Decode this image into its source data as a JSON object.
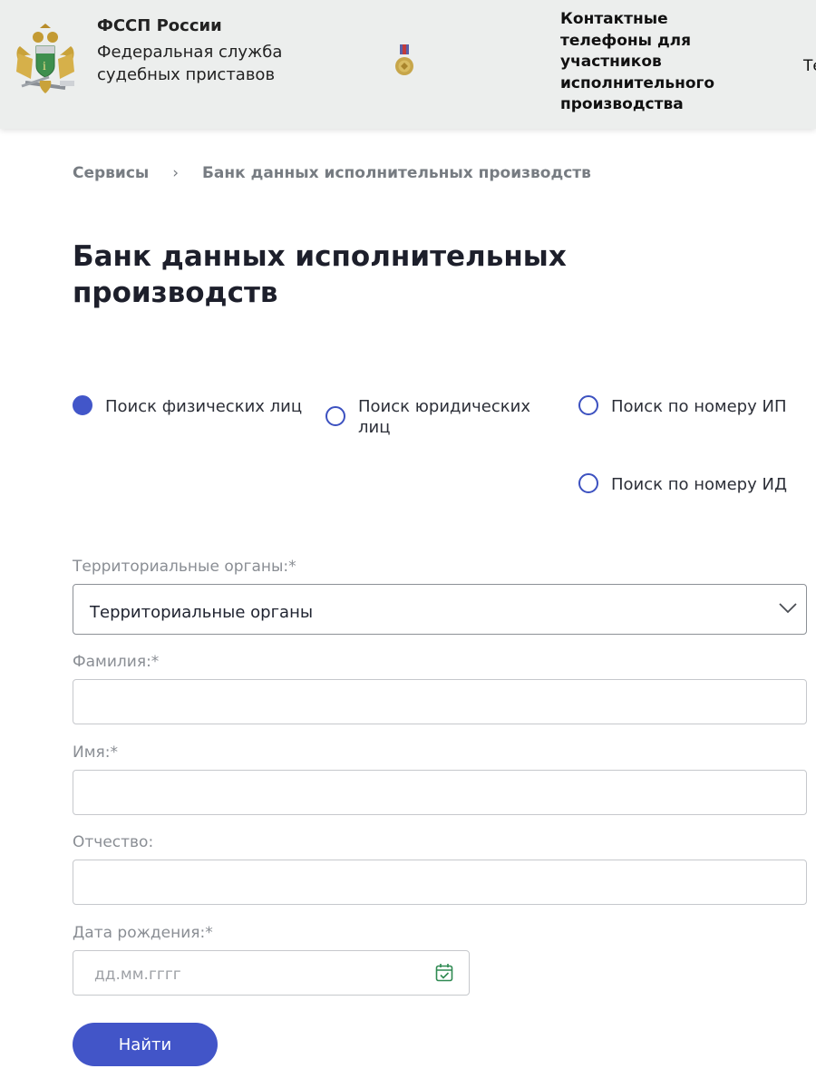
{
  "header": {
    "org_short": "ФССП России",
    "org_full": "Федеральная служба судебных приставов",
    "contacts_link": "Контактные телефоны для участников исполнительного производства",
    "cut_text": "Те"
  },
  "breadcrumb": {
    "items": [
      "Сервисы",
      "Банк данных исполнительных производств"
    ],
    "separator": "›"
  },
  "page": {
    "title": "Банк данных исполнительных производств"
  },
  "search_modes": [
    {
      "label": "Поиск физических лиц",
      "checked": true
    },
    {
      "label": "Поиск юридических лиц",
      "checked": false
    },
    {
      "label": "Поиск по номеру ИП",
      "checked": false
    },
    {
      "label": "Поиск по номеру ИД",
      "checked": false
    }
  ],
  "form": {
    "territory_label": "Территориальные органы:*",
    "territory_value": "Территориальные органы",
    "lastname_label": "Фамилия:*",
    "lastname_value": "",
    "firstname_label": "Имя:*",
    "firstname_value": "",
    "patronymic_label": "Отчество:",
    "patronymic_value": "",
    "birthdate_label": "Дата рождения:*",
    "birthdate_placeholder": "дд.мм.гггг",
    "submit_label": "Найти"
  },
  "icons": {
    "emblem": "fssp-emblem-icon",
    "medal": "medal-icon",
    "chevron": "chevron-down-icon",
    "calendar": "calendar-icon"
  },
  "colors": {
    "accent": "#4255c8",
    "header_bg": "#eceeed",
    "calendar_icon": "#2f8a52"
  }
}
